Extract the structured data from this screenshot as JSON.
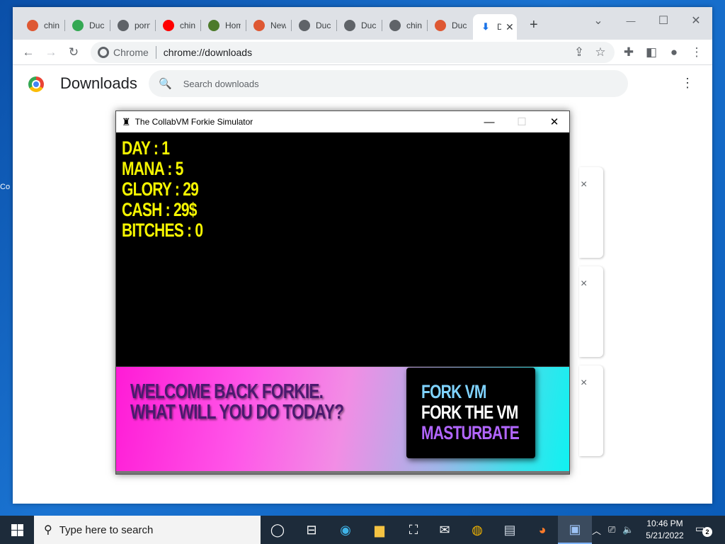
{
  "desktop": {
    "edge_labels": [
      "Co"
    ]
  },
  "browser": {
    "tabs": [
      {
        "label": "chin",
        "icon": "duckduckgo-icon",
        "color": "#de5833"
      },
      {
        "label": "Duck",
        "icon": "drive-icon",
        "color": "#34a853"
      },
      {
        "label": "porn",
        "icon": "globe-icon",
        "color": "#5f6368"
      },
      {
        "label": "chin",
        "icon": "youtube-icon",
        "color": "#ff0000"
      },
      {
        "label": "Hom",
        "icon": "thumbnail-icon",
        "color": "#4d7a2a"
      },
      {
        "label": "New",
        "icon": "duckduckgo-icon",
        "color": "#de5833"
      },
      {
        "label": "Duck",
        "icon": "globe-icon",
        "color": "#5f6368"
      },
      {
        "label": "Duck",
        "icon": "globe-icon",
        "color": "#5f6368"
      },
      {
        "label": "chin",
        "icon": "globe-icon",
        "color": "#5f6368"
      },
      {
        "label": "Duck",
        "icon": "duckduckgo-icon",
        "color": "#de5833"
      },
      {
        "label": "D",
        "icon": "download-icon",
        "color": "#1a73e8",
        "active": true
      }
    ],
    "omnibox": {
      "site_label": "Chrome",
      "url": "chrome://downloads"
    }
  },
  "downloads": {
    "title": "Downloads",
    "search_placeholder": "Search downloads",
    "close_symbol": "×"
  },
  "app": {
    "title": "The CollabVM Forkie Simulator",
    "stats": [
      {
        "label": "DAY",
        "value": "1"
      },
      {
        "label": "MANA",
        "value": "5"
      },
      {
        "label": "GLORY",
        "value": "29"
      },
      {
        "label": "CASH",
        "value": "29$"
      },
      {
        "label": "BITCHES",
        "value": "0"
      }
    ],
    "welcome_line1": "WELCOME BACK FORKIE.",
    "welcome_line2": "WHAT WILL YOU DO TODAY?",
    "menu": [
      {
        "label": "FORK VM",
        "color": "#7fd3ff"
      },
      {
        "label": "FORK THE VM",
        "color": "#ffffff"
      },
      {
        "label": "MASTURBATE",
        "color": "#b266ff"
      }
    ]
  },
  "taskbar": {
    "search_placeholder": "Type here to search",
    "time": "10:46 PM",
    "date": "5/21/2022",
    "notification_count": "2"
  }
}
